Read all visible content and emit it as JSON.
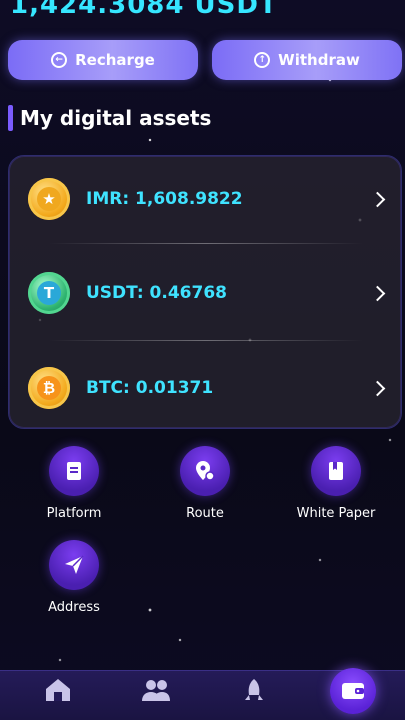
{
  "header": {
    "balance": "1,424.3084 USDT"
  },
  "actions": {
    "recharge_label": "Recharge",
    "withdraw_label": "Withdraw"
  },
  "assets_section": {
    "title": "My digital assets",
    "items": [
      {
        "label": "IMR: 1,608.9822",
        "icon": "imr-coin-icon"
      },
      {
        "label": "USDT: 0.46768",
        "icon": "usdt-coin-icon"
      },
      {
        "label": "BTC: 0.01371",
        "icon": "btc-coin-icon"
      }
    ]
  },
  "menu": {
    "items": [
      {
        "label": "Platform",
        "icon": "document-icon"
      },
      {
        "label": "Route",
        "icon": "route-pin-icon"
      },
      {
        "label": "White Paper",
        "icon": "book-icon"
      },
      {
        "label": "Address",
        "icon": "send-icon"
      }
    ]
  },
  "tabbar": {
    "items": [
      {
        "icon": "home-icon"
      },
      {
        "icon": "team-icon"
      },
      {
        "icon": "rocket-icon"
      },
      {
        "icon": "wallet-icon",
        "active": true
      }
    ]
  },
  "colors": {
    "accent_cyan": "#3fe3ff",
    "button_purple": "#8f84f7",
    "menu_purple": "#5a28c8",
    "background": "#0b0a1c"
  }
}
